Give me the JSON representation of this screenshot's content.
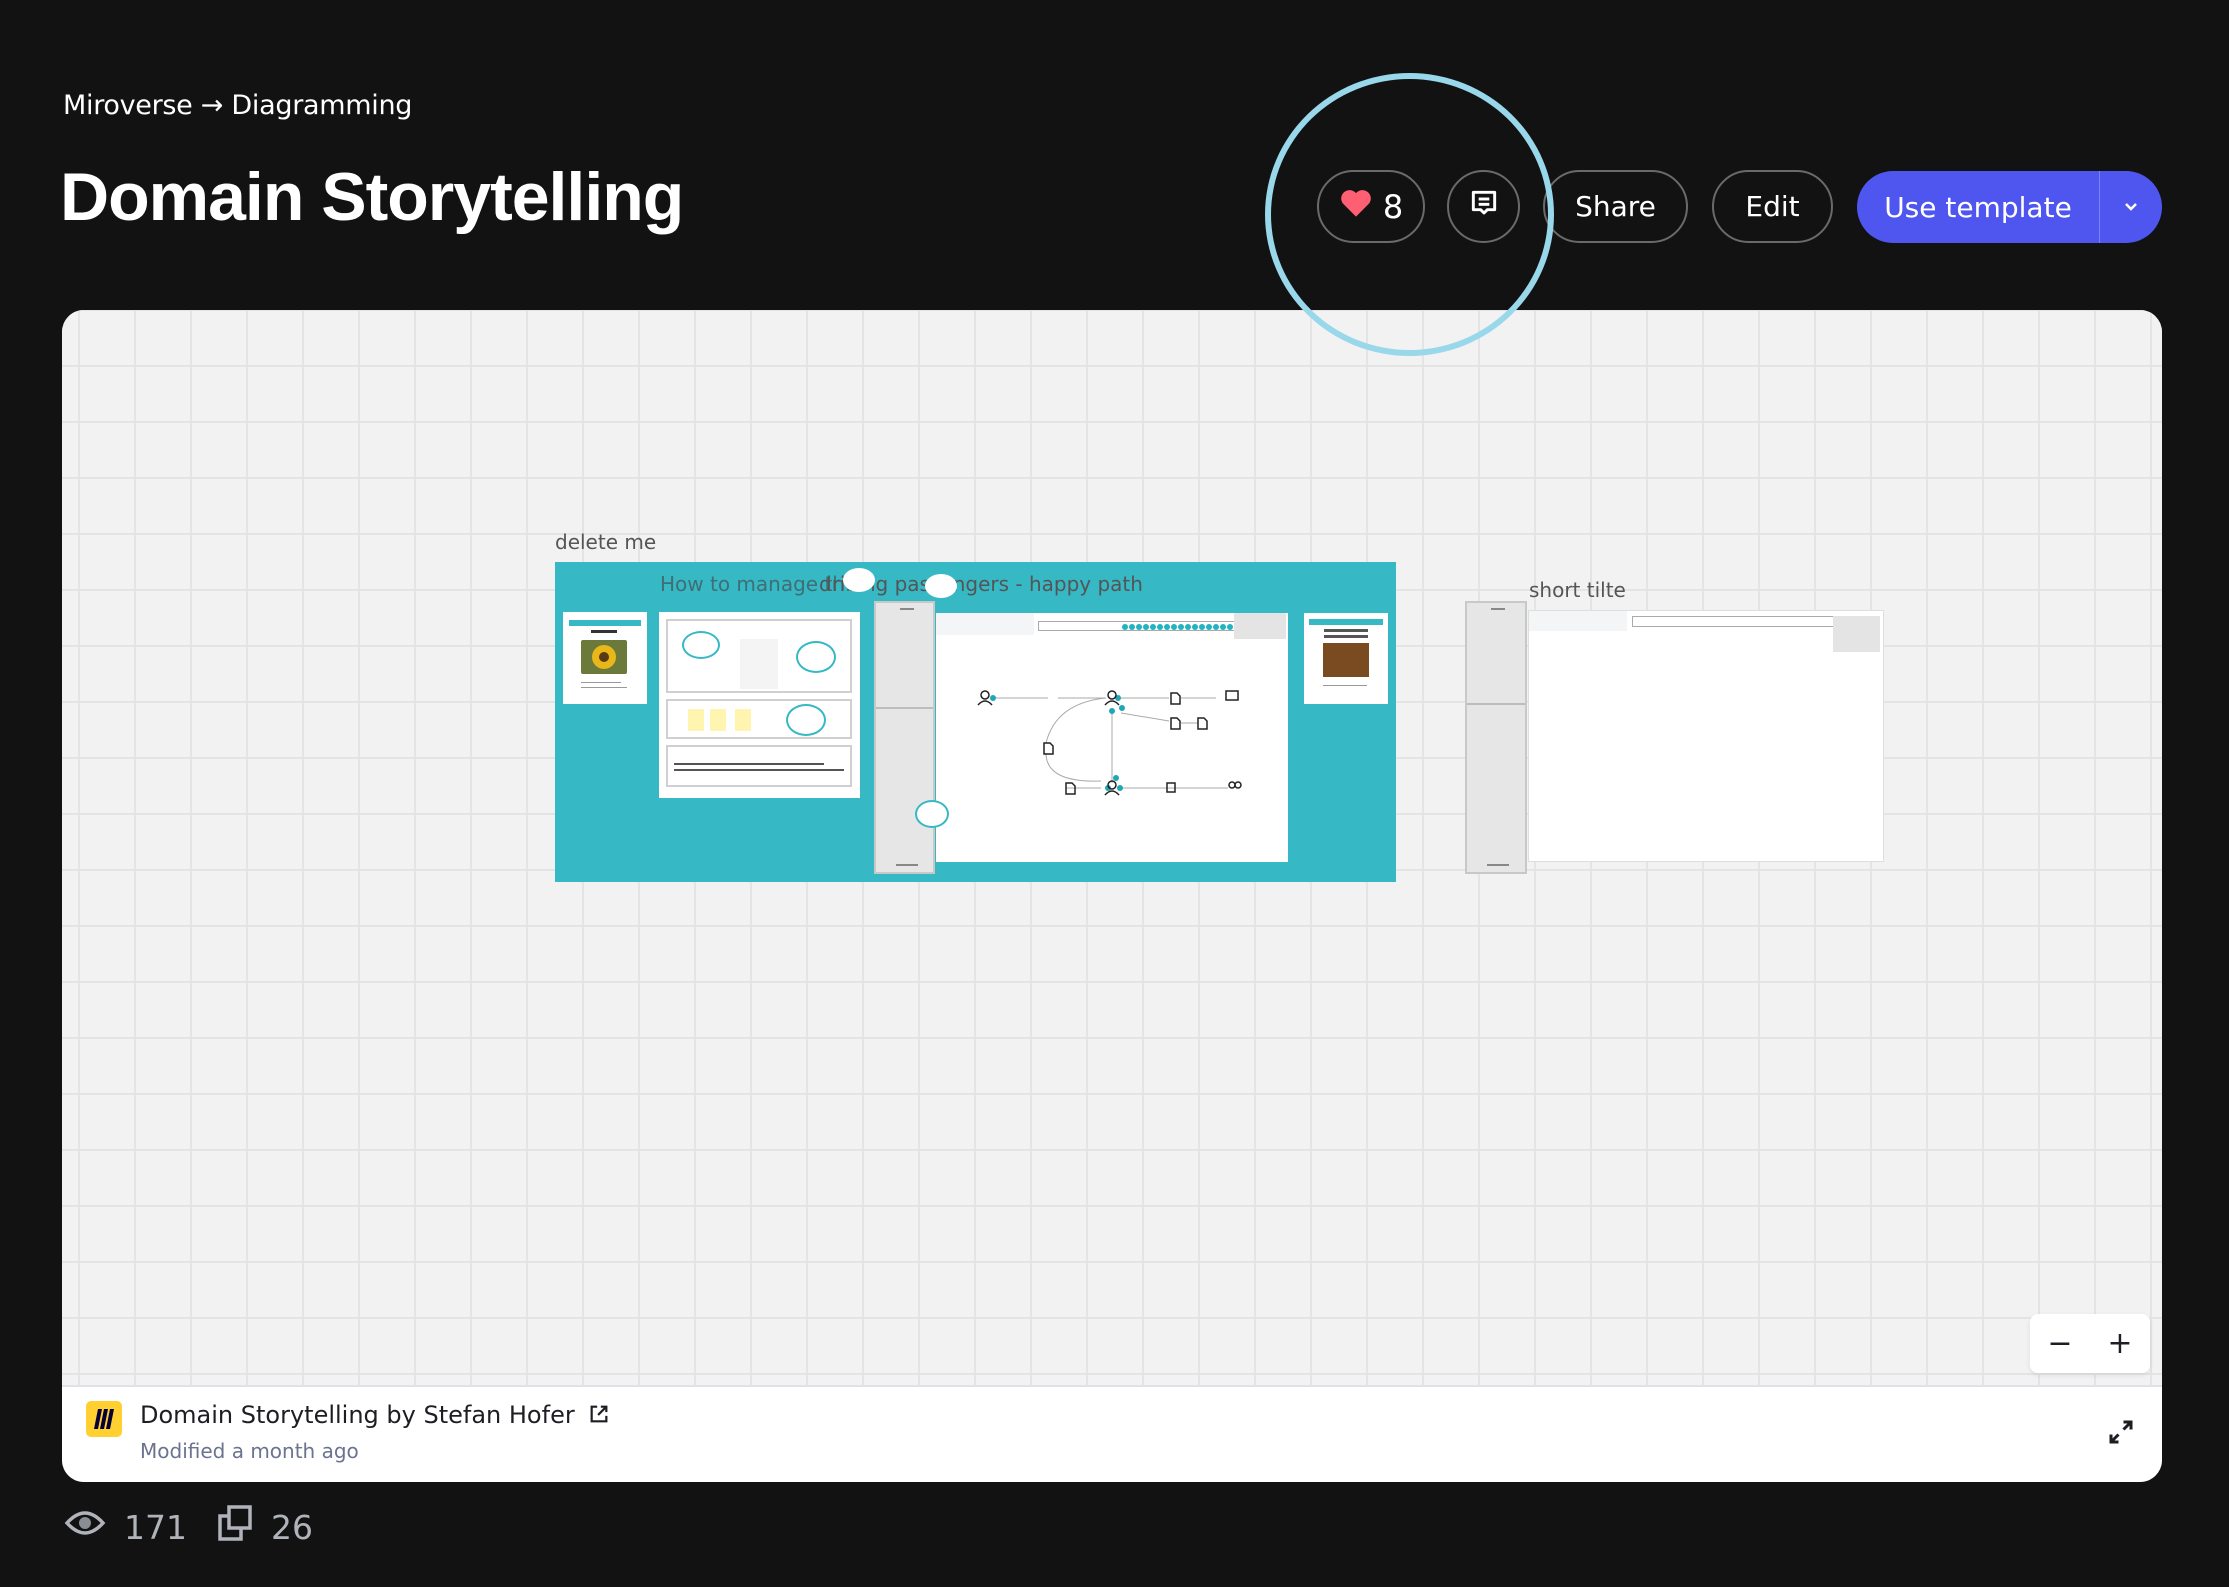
{
  "breadcrumb": {
    "root": "Miroverse",
    "separator": "→",
    "category": "Diagramming"
  },
  "page": {
    "title": "Domain Storytelling"
  },
  "actions": {
    "likes": "8",
    "share_label": "Share",
    "edit_label": "Edit",
    "use_template_label": "Use template"
  },
  "colors": {
    "background": "#121212",
    "accent": "#4f56f0",
    "heart": "#ff5f73",
    "frame": "#36b8c5",
    "annotation": "#98d8ea",
    "logo": "#ffd02f"
  },
  "board": {
    "frames": [
      {
        "label": "delete me"
      },
      {
        "label": "How to manage th..."
      },
      {
        "label": "driving passengers - happy path"
      },
      {
        "label": "short tilte"
      }
    ],
    "zoom_out": "−",
    "zoom_in": "+"
  },
  "footer": {
    "title": "Domain Storytelling by Stefan Hofer",
    "modified": "Modified a month ago"
  },
  "stats": {
    "views": "171",
    "copies": "26"
  }
}
